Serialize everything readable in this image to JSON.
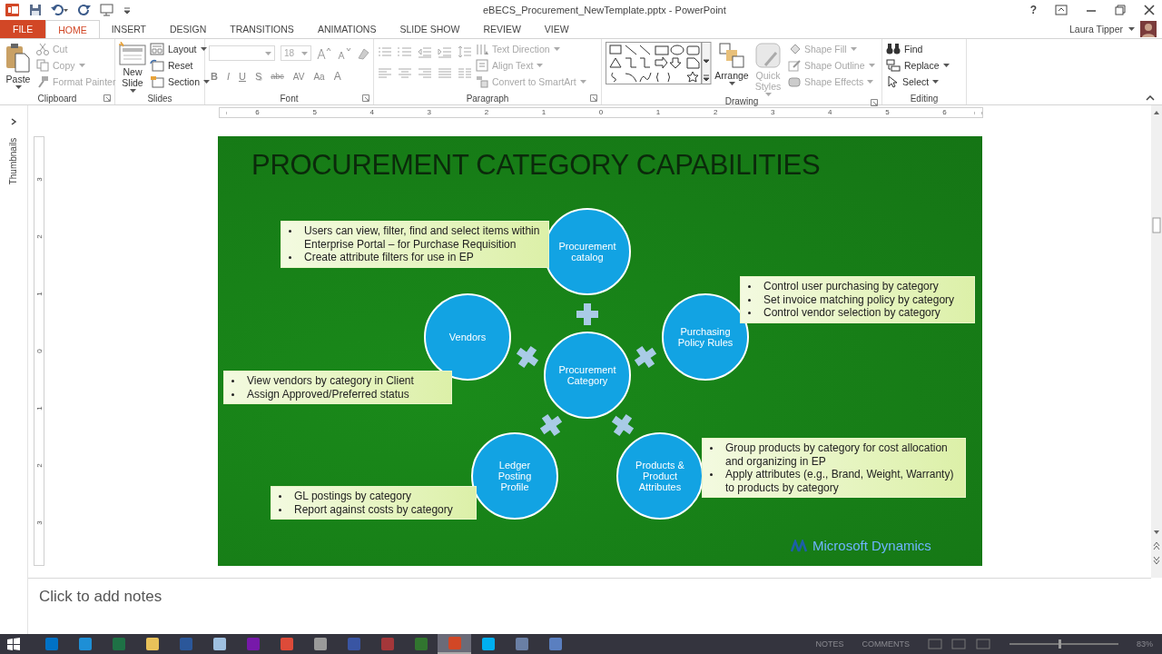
{
  "window": {
    "title": "eBECS_Procurement_NewTemplate.pptx - PowerPoint",
    "help": "?",
    "user": "Laura Tipper"
  },
  "tabs": [
    {
      "label": "FILE",
      "kind": "file",
      "selected": false
    },
    {
      "label": "HOME",
      "kind": "tab",
      "selected": true
    },
    {
      "label": "INSERT",
      "kind": "tab",
      "selected": false
    },
    {
      "label": "DESIGN",
      "kind": "tab",
      "selected": false
    },
    {
      "label": "TRANSITIONS",
      "kind": "tab",
      "selected": false
    },
    {
      "label": "ANIMATIONS",
      "kind": "tab",
      "selected": false
    },
    {
      "label": "SLIDE SHOW",
      "kind": "tab",
      "selected": false
    },
    {
      "label": "REVIEW",
      "kind": "tab",
      "selected": false
    },
    {
      "label": "VIEW",
      "kind": "tab",
      "selected": false
    }
  ],
  "ribbon": {
    "groups": [
      {
        "kind": "clipboard",
        "label": "Clipboard",
        "launcher": true,
        "big": [
          {
            "label": "Paste",
            "kind": "paste",
            "disabled": false,
            "dropdown": true
          }
        ],
        "small": [
          {
            "label": "Cut",
            "kind": "cut",
            "disabled": true,
            "dropdown": false
          },
          {
            "label": "Copy",
            "kind": "copy",
            "disabled": true,
            "dropdown": true
          },
          {
            "label": "Format Painter",
            "kind": "painter",
            "disabled": true,
            "dropdown": false
          }
        ]
      },
      {
        "kind": "slides",
        "label": "Slides",
        "launcher": false,
        "big": [
          {
            "label": "New Slide",
            "kind": "newslide",
            "disabled": false,
            "dropdown": true
          }
        ],
        "small": [
          {
            "label": "Layout",
            "kind": "layout",
            "disabled": false,
            "dropdown": true
          },
          {
            "label": "Reset",
            "kind": "reset",
            "disabled": false,
            "dropdown": false
          },
          {
            "label": "Section",
            "kind": "section",
            "disabled": false,
            "dropdown": true
          }
        ]
      },
      {
        "kind": "font",
        "label": "Font",
        "launcher": true,
        "disabled": true,
        "font_size": "18",
        "formats": [
          {
            "label": "B",
            "kind": "bold"
          },
          {
            "label": "I",
            "kind": "italic"
          },
          {
            "label": "U",
            "kind": "underline"
          },
          {
            "label": "S",
            "kind": "shadow"
          },
          {
            "label": "abc",
            "kind": "strike"
          },
          {
            "label": "AV",
            "kind": "spacing"
          },
          {
            "label": "Aa",
            "kind": "case"
          },
          {
            "label": "A",
            "kind": "color"
          }
        ]
      },
      {
        "kind": "paragraph",
        "label": "Paragraph",
        "launcher": true,
        "disabled": true,
        "small": [
          {
            "label": "Text Direction",
            "kind": "textdir",
            "disabled": true,
            "dropdown": true
          },
          {
            "label": "Align Text",
            "kind": "align",
            "disabled": true,
            "dropdown": true
          },
          {
            "label": "Convert to SmartArt",
            "kind": "smartart",
            "disabled": true,
            "dropdown": true
          }
        ]
      },
      {
        "kind": "drawing",
        "label": "Drawing",
        "launcher": true,
        "big": [
          {
            "label": "Arrange",
            "kind": "arrange",
            "disabled": false,
            "dropdown": true
          },
          {
            "label": "Quick Styles",
            "kind": "quickstyles",
            "disabled": true,
            "dropdown": true
          }
        ],
        "small": [
          {
            "label": "Shape Fill",
            "kind": "fill",
            "disabled": true,
            "dropdown": true
          },
          {
            "label": "Shape Outline",
            "kind": "outline",
            "disabled": true,
            "dropdown": true
          },
          {
            "label": "Shape Effects",
            "kind": "effects",
            "disabled": true,
            "dropdown": true
          }
        ]
      },
      {
        "kind": "editing",
        "label": "Editing",
        "launcher": false,
        "small": [
          {
            "label": "Find",
            "kind": "find",
            "disabled": false,
            "dropdown": false
          },
          {
            "label": "Replace",
            "kind": "replace",
            "disabled": false,
            "dropdown": true
          },
          {
            "label": "Select",
            "kind": "select",
            "disabled": false,
            "dropdown": true
          }
        ]
      }
    ]
  },
  "thumbnails_pane": {
    "label": "Thumbnails"
  },
  "ruler": {
    "horizontal": [
      "6",
      "5",
      "4",
      "3",
      "2",
      "1",
      "0",
      "1",
      "2",
      "3",
      "4",
      "5",
      "6"
    ],
    "vertical": [
      "3",
      "2",
      "1",
      "0",
      "1",
      "2",
      "3"
    ]
  },
  "slide": {
    "title": "PROCUREMENT CATEGORY CAPABILITIES",
    "nodes": [
      {
        "label": "Procurement catalog"
      },
      {
        "label": "Vendors"
      },
      {
        "label": "Procurement Category"
      },
      {
        "label": "Purchasing Policy Rules"
      },
      {
        "label": "Ledger Posting Profile"
      },
      {
        "label": "Products & Product Attributes"
      }
    ],
    "callouts": [
      {
        "bullets": [
          "Users can view, filter, find and select items within Enterprise Portal – for Purchase Requisition",
          "Create attribute filters for use in EP"
        ]
      },
      {
        "bullets": [
          "Control user purchasing by category",
          "Set invoice matching policy by category",
          "Control vendor selection by category"
        ]
      },
      {
        "bullets": [
          "View vendors by category in Client",
          "Assign Approved/Preferred status"
        ]
      },
      {
        "bullets": [
          "GL postings by category",
          "Report against costs by category"
        ]
      },
      {
        "bullets": [
          "Group products by category for cost allocation and organizing in EP",
          "Apply attributes (e.g., Brand, Weight, Warranty) to products by category"
        ]
      }
    ],
    "logo": "Microsoft Dynamics"
  },
  "notes": {
    "placeholder": "Click to add notes"
  },
  "taskbar": {
    "apps": [
      {
        "color": "#0072c6",
        "selected": false
      },
      {
        "color": "#1e8fd6",
        "selected": false
      },
      {
        "color": "#1e7145",
        "selected": false
      },
      {
        "color": "#e8c15a",
        "selected": false
      },
      {
        "color": "#2b579a",
        "selected": false
      },
      {
        "color": "#9fc0e0",
        "selected": false
      },
      {
        "color": "#7719aa",
        "selected": false
      },
      {
        "color": "#dd4b39",
        "selected": false
      },
      {
        "color": "#9a9a9a",
        "selected": false
      },
      {
        "color": "#3955a3",
        "selected": false
      },
      {
        "color": "#a4373a",
        "selected": false
      },
      {
        "color": "#31752f",
        "selected": false
      },
      {
        "color": "#d24726",
        "selected": true
      },
      {
        "color": "#00aff0",
        "selected": false
      },
      {
        "color": "#6a7fa5",
        "selected": false
      },
      {
        "color": "#5a7fc0",
        "selected": false
      }
    ],
    "status": {
      "notes": "NOTES",
      "comments": "COMMENTS",
      "zoom": {
        "level": 0.46,
        "reading": "83%"
      }
    }
  }
}
